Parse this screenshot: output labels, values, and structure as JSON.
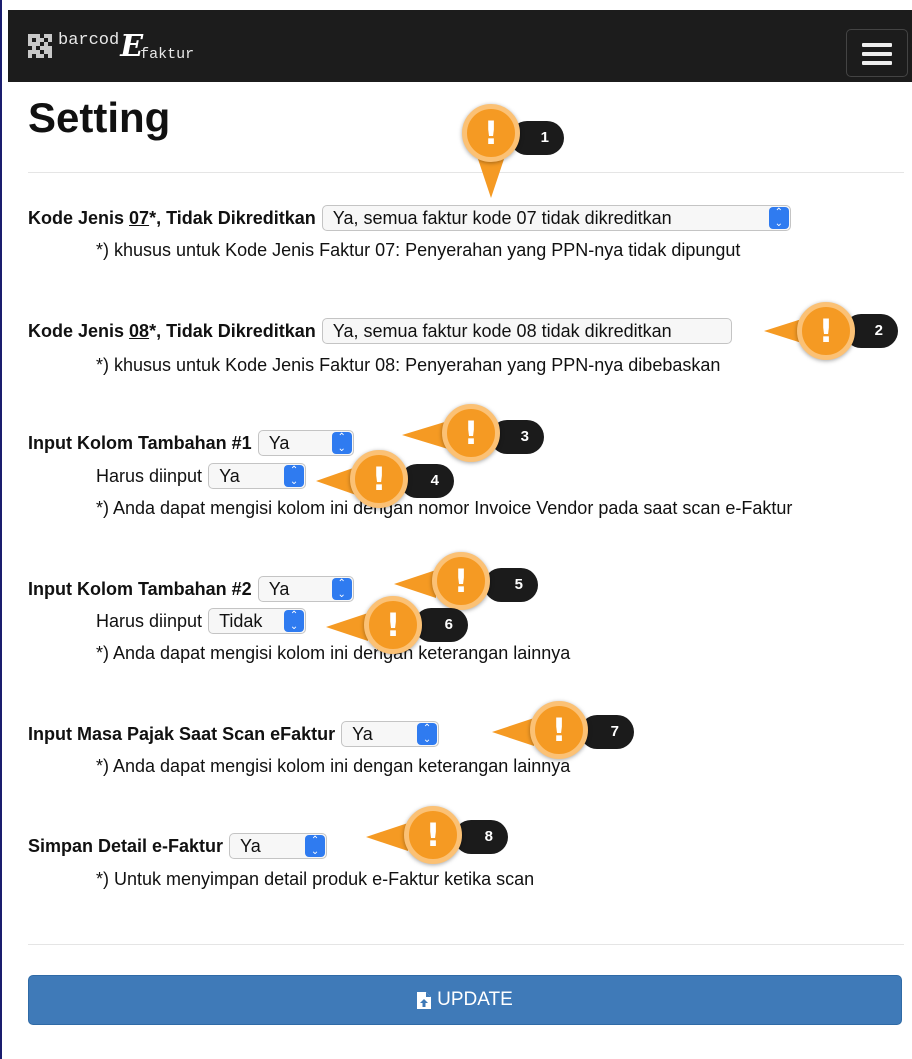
{
  "app": {
    "brand_pre": "barcod",
    "brand_e": "E",
    "brand_post": "faktur"
  },
  "icons": {
    "logo": "qr-code-icon",
    "menu": "hamburger-menu-icon",
    "update": "file-upload-icon",
    "marker": "exclamation-icon"
  },
  "colors": {
    "navbar": "#1c1c1c",
    "accent_blue": "#3f7ab8",
    "marker_orange": "#f59a23",
    "marker_badge": "#1b1b1b"
  },
  "page": {
    "title": "Setting"
  },
  "settings": {
    "kode07": {
      "label_pre": "Kode Jenis ",
      "label_code": "07",
      "label_post": "*, Tidak Dikreditkan",
      "value": "Ya, semua faktur kode 07 tidak dikreditkan",
      "note": "*) khusus untuk Kode Jenis Faktur 07: Penyerahan yang PPN-nya tidak dipungut"
    },
    "kode08": {
      "label_pre": "Kode Jenis ",
      "label_code": "08",
      "label_post": "*, Tidak Dikreditkan",
      "value": "Ya, semua faktur kode 08 tidak dikreditkan",
      "note": "*) khusus untuk Kode Jenis Faktur 08: Penyerahan yang PPN-nya dibebaskan"
    },
    "kolom1": {
      "label": "Input Kolom Tambahan #1",
      "value": "Ya",
      "required_label": "Harus diinput",
      "required_value": "Ya",
      "note": "*) Anda dapat mengisi kolom ini dengan nomor Invoice Vendor pada saat scan e-Faktur"
    },
    "kolom2": {
      "label": "Input Kolom Tambahan #2",
      "value": "Ya",
      "required_label": "Harus diinput",
      "required_value": "Tidak",
      "note": "*) Anda dapat mengisi kolom ini dengan keterangan lainnya"
    },
    "masa": {
      "label": "Input Masa Pajak Saat Scan eFaktur",
      "value": "Ya",
      "note": "*) Anda dapat mengisi kolom ini dengan keterangan lainnya"
    },
    "detail": {
      "label": "Simpan Detail e-Faktur",
      "value": "Ya",
      "note": "*) Untuk menyimpan detail produk e-Faktur ketika scan"
    }
  },
  "markers": [
    "1",
    "2",
    "3",
    "4",
    "5",
    "6",
    "7",
    "8"
  ],
  "update_button": {
    "label": "UPDATE"
  }
}
